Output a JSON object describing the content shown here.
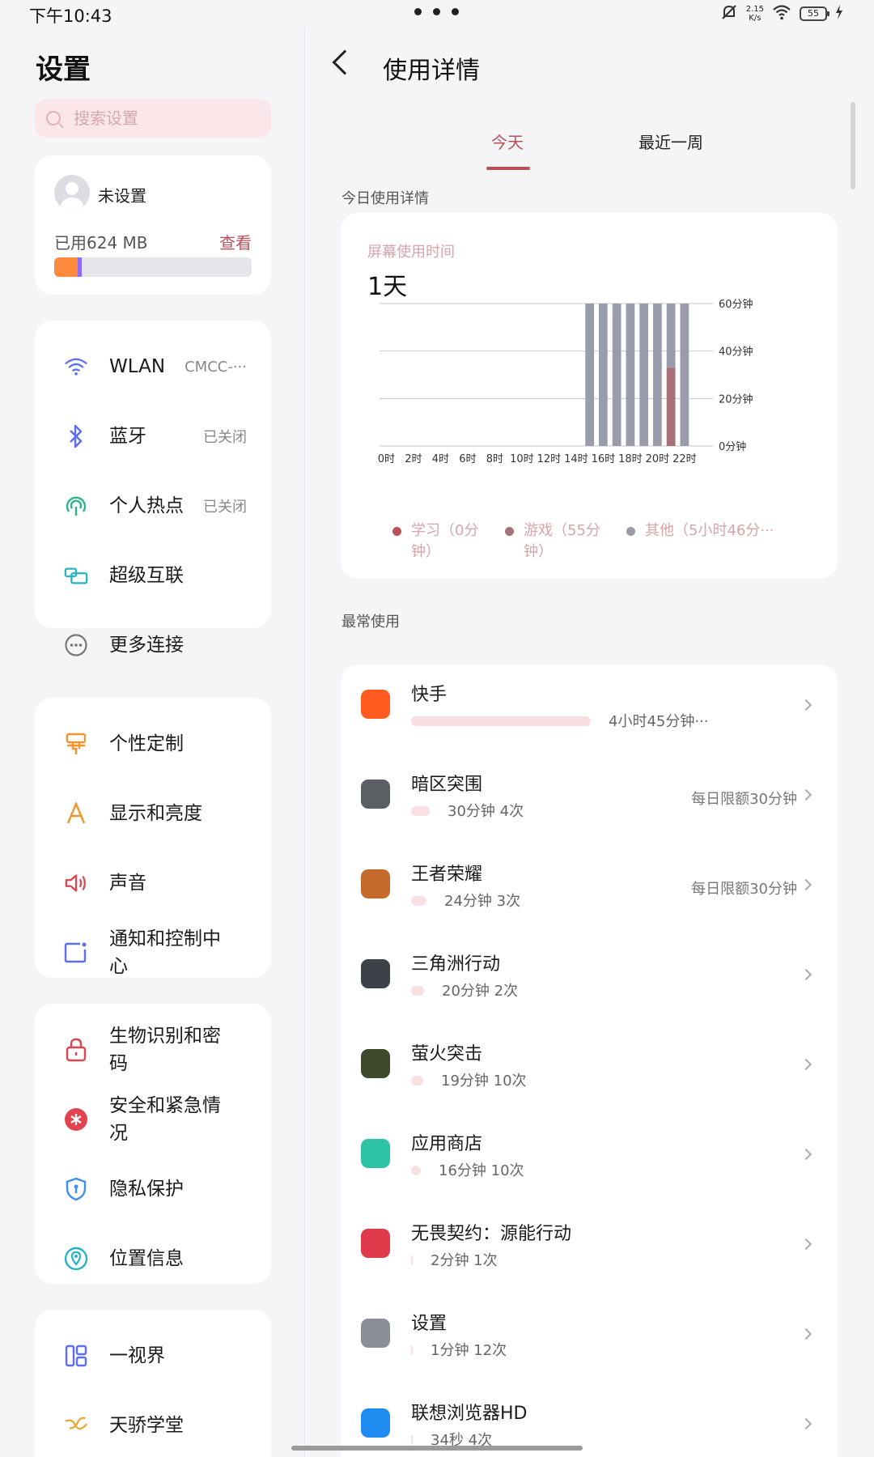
{
  "status_bar": {
    "time": "下午10:43",
    "net_speed_value": "2.15",
    "net_speed_unit": "K/s",
    "battery": "55"
  },
  "settings": {
    "title": "设置",
    "search_placeholder": "搜索设置",
    "account": {
      "name": "未设置",
      "used": "已用624 MB",
      "view_label": "查看",
      "storage_segments": [
        0.12,
        0.02
      ]
    },
    "groups": [
      [
        {
          "icon": "wifi-icon",
          "label": "WLAN",
          "value": "CMCC-···"
        },
        {
          "icon": "bluetooth-icon",
          "label": "蓝牙",
          "value": "已关闭"
        },
        {
          "icon": "hotspot-icon",
          "label": "个人热点",
          "value": "已关闭"
        },
        {
          "icon": "super-link-icon",
          "label": "超级互联",
          "value": ""
        },
        {
          "icon": "more-connections-icon",
          "label": "更多连接",
          "value": ""
        }
      ],
      [
        {
          "icon": "personalize-icon",
          "label": "个性定制"
        },
        {
          "icon": "display-icon",
          "label": "显示和亮度"
        },
        {
          "icon": "sound-icon",
          "label": "声音"
        },
        {
          "icon": "notification-icon",
          "label": "通知和控制中心"
        }
      ],
      [
        {
          "icon": "lock-icon",
          "label": "生物识别和密码"
        },
        {
          "icon": "emergency-icon",
          "label": "安全和紧急情况"
        },
        {
          "icon": "privacy-shield-icon",
          "label": "隐私保护"
        },
        {
          "icon": "location-icon",
          "label": "位置信息"
        }
      ],
      [
        {
          "icon": "multiview-icon",
          "label": "一视界"
        },
        {
          "icon": "tianjiao-icon",
          "label": "天骄学堂"
        }
      ]
    ]
  },
  "detail": {
    "title": "使用详情",
    "tabs": [
      "今天",
      "最近一周"
    ],
    "active_tab": 0,
    "today_section": "今日使用详情",
    "screen_time_label": "屏幕使用时间",
    "screen_time_value": "1天",
    "legend": [
      "学习（0分钟）",
      "游戏（55分钟）",
      "其他（5小时46分···"
    ],
    "most_used_section": "最常使用",
    "apps": [
      {
        "name": "快手",
        "usage": "4小时45分钟···",
        "limit": "",
        "bar": 1.0,
        "icon_color": "#ff5a1f"
      },
      {
        "name": "暗区突围",
        "usage": "30分钟 4次",
        "limit": "每日限额30分钟",
        "bar": 0.105,
        "icon_color": "#5a5f63"
      },
      {
        "name": "王者荣耀",
        "usage": "24分钟 3次",
        "limit": "每日限额30分钟",
        "bar": 0.084,
        "icon_color": "#c66a2c"
      },
      {
        "name": "三角洲行动",
        "usage": "20分钟 2次",
        "limit": "",
        "bar": 0.07,
        "icon_color": "#3c4247"
      },
      {
        "name": "萤火突击",
        "usage": "19分钟 10次",
        "limit": "",
        "bar": 0.067,
        "icon_color": "#3f4a2c"
      },
      {
        "name": "应用商店",
        "usage": "16分钟 10次",
        "limit": "",
        "bar": 0.056,
        "icon_color": "#2dc4a5"
      },
      {
        "name": "无畏契约：源能行动",
        "usage": "2分钟 1次",
        "limit": "",
        "bar": 0.007,
        "icon_color": "#e03a4a"
      },
      {
        "name": "设置",
        "usage": "1分钟 12次",
        "limit": "",
        "bar": 0.004,
        "icon_color": "#8a8f98"
      },
      {
        "name": "联想浏览器HD",
        "usage": "34秒 4次",
        "limit": "",
        "bar": 0.002,
        "icon_color": "#1e8cf0"
      }
    ]
  },
  "chart_data": {
    "type": "bar",
    "categories": [
      "0时",
      "1时",
      "2时",
      "3时",
      "4时",
      "5时",
      "6时",
      "7时",
      "8时",
      "9时",
      "10时",
      "11时",
      "12时",
      "13时",
      "14时",
      "15时",
      "16时",
      "17时",
      "18时",
      "19时",
      "20时",
      "21时",
      "22时",
      "23时"
    ],
    "x_tick_labels": [
      "0时",
      "2时",
      "4时",
      "6时",
      "8时",
      "10时",
      "12时",
      "14时",
      "16时",
      "18时",
      "20时",
      "22时"
    ],
    "y_tick_labels": [
      "0分钟",
      "20分钟",
      "40分钟",
      "60分钟"
    ],
    "ylim": [
      0,
      60
    ],
    "series": [
      {
        "name": "学习",
        "color": "#b85058",
        "values": [
          0,
          0,
          0,
          0,
          0,
          0,
          0,
          0,
          0,
          0,
          0,
          0,
          0,
          0,
          0,
          0,
          0,
          0,
          0,
          0,
          0,
          0,
          0,
          0
        ]
      },
      {
        "name": "游戏",
        "color": "#a87078",
        "values": [
          0,
          0,
          0,
          0,
          0,
          0,
          0,
          0,
          0,
          0,
          0,
          0,
          0,
          0,
          0,
          0,
          0,
          0,
          0,
          0,
          0,
          33,
          0,
          0
        ]
      },
      {
        "name": "其他",
        "color": "#9a9cab",
        "values": [
          0,
          0,
          0,
          0,
          0,
          0,
          0,
          0,
          0,
          0,
          0,
          0,
          0,
          0,
          0,
          60,
          60,
          60,
          60,
          60,
          60,
          27,
          60,
          0
        ]
      }
    ],
    "grid": true
  }
}
